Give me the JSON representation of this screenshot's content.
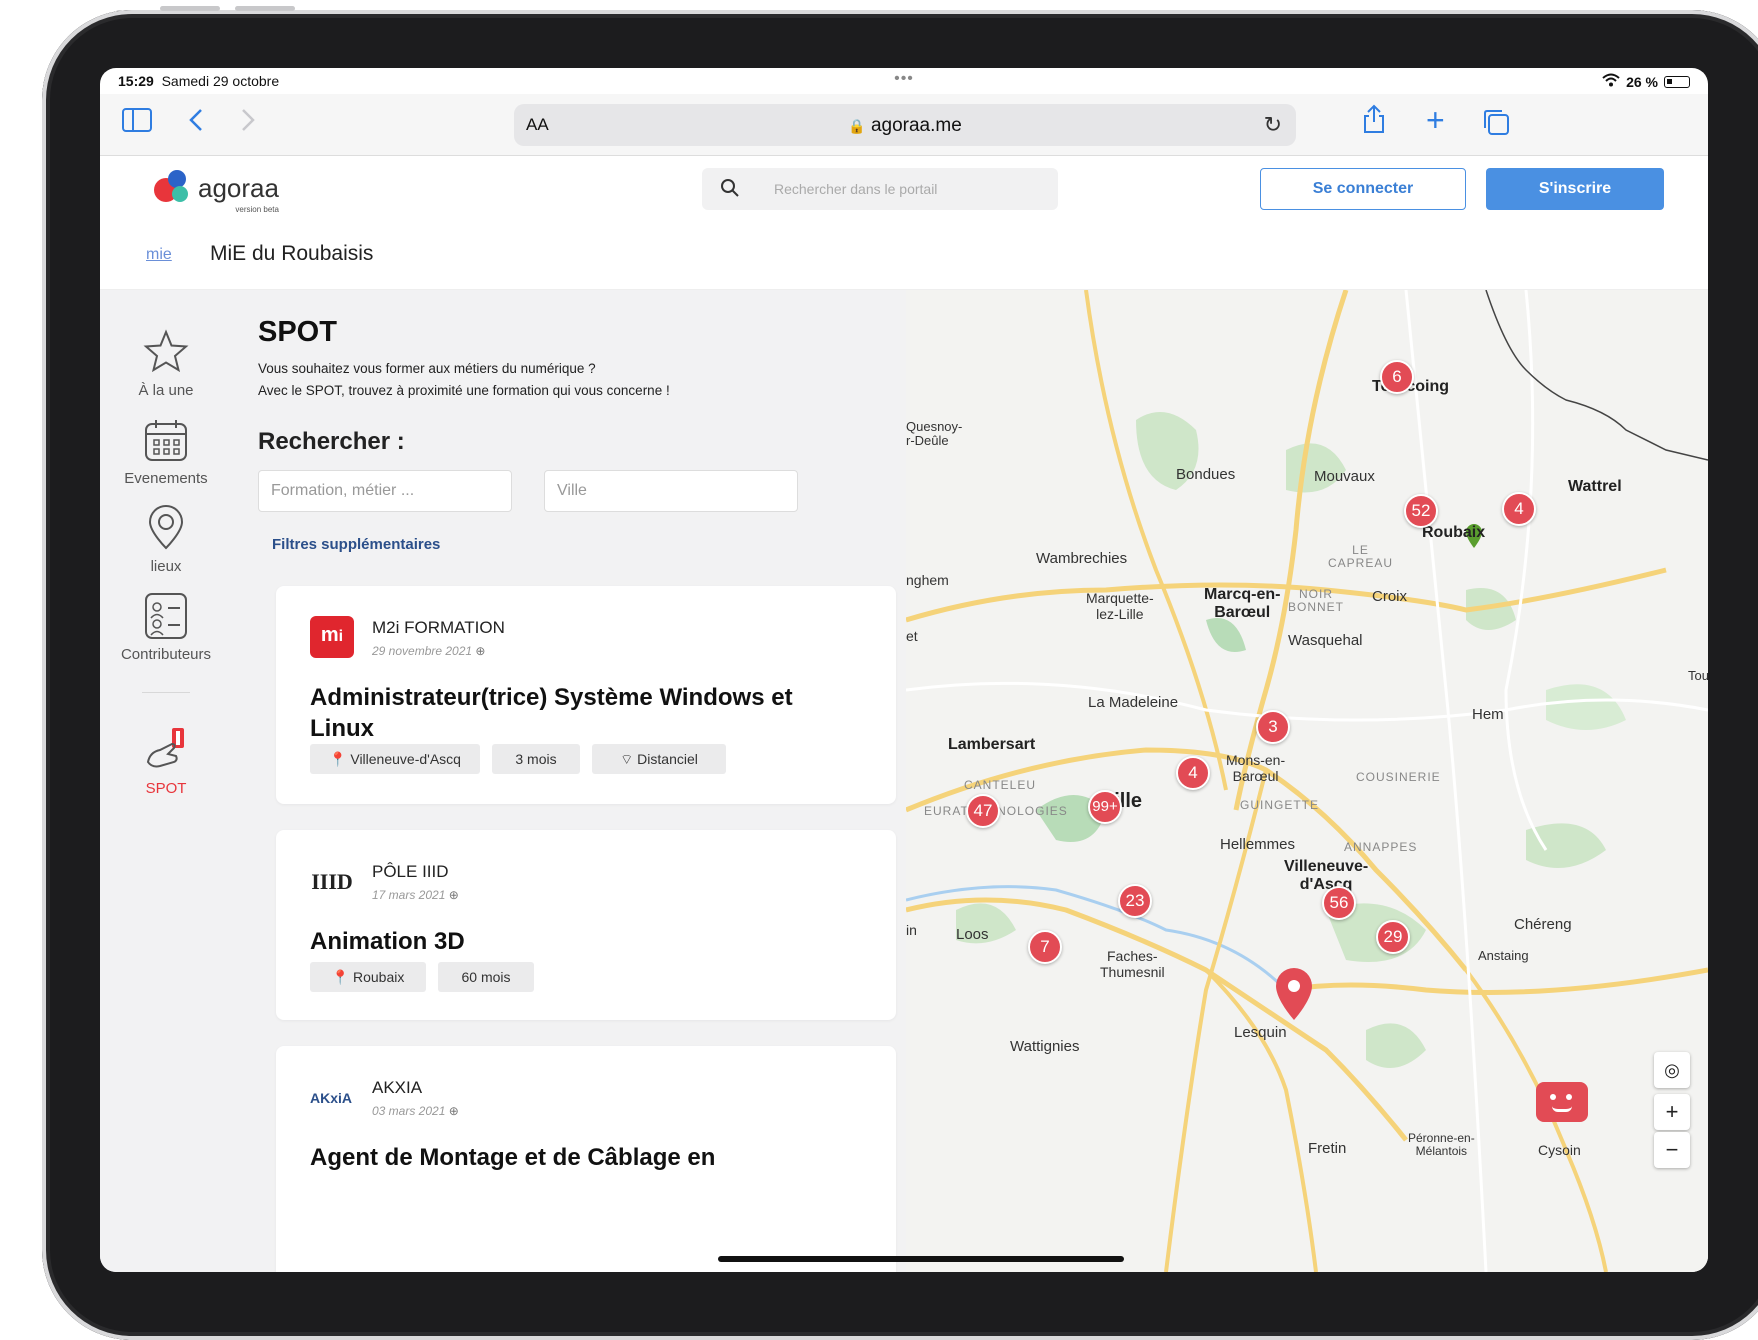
{
  "status_bar": {
    "time": "15:29",
    "date": "Samedi 29 octobre",
    "battery": "26 %"
  },
  "browser": {
    "text_size": "AA",
    "url": "agoraa.me"
  },
  "header": {
    "logo_text": "agoraa",
    "logo_sub": "version beta",
    "search_placeholder": "Rechercher dans le portail",
    "login_label": "Se connecter",
    "signup_label": "S'inscrire"
  },
  "org": {
    "short": "mie",
    "title": "MiE du Roubaisis"
  },
  "sidenav": {
    "items": [
      {
        "label": "À la une",
        "icon": "star-icon"
      },
      {
        "label": "Evenements",
        "icon": "calendar-icon"
      },
      {
        "label": "lieux",
        "icon": "location-pin-icon"
      },
      {
        "label": "Contributeurs",
        "icon": "contacts-icon"
      },
      {
        "label": "SPOT",
        "icon": "spot-hand-icon"
      }
    ]
  },
  "spot": {
    "title": "SPOT",
    "desc_line1": "Vous souhaitez vous former aux métiers du numérique ?",
    "desc_line2": "Avec le SPOT, trouvez à proximité une formation qui vous concerne !",
    "search_label": "Rechercher :",
    "formation_placeholder": "Formation, métier ...",
    "ville_placeholder": "Ville",
    "filters_label": "Filtres supplémentaires"
  },
  "cards": [
    {
      "org": "M2i FORMATION",
      "date": "29 novembre 2021",
      "title": "Administrateur(trice) Système Windows et Linux",
      "tags": [
        "Villeneuve-d'Ascq",
        "3 mois",
        "Distanciel"
      ]
    },
    {
      "org": "PÔLE IIID",
      "date": "17 mars 2021",
      "title": "Animation 3D",
      "tags": [
        "Roubaix",
        "60 mois"
      ]
    },
    {
      "org": "AKXIA",
      "date": "03 mars 2021",
      "title": "Agent de Montage et de Câblage en"
    }
  ],
  "map": {
    "labels": {
      "tourcoing": "Tourcoing",
      "roubaix": "Roubaix",
      "wattrelos": "Wattrel",
      "bondues": "Bondues",
      "mouvaux": "Mouvaux",
      "wambrechies": "Wambrechies",
      "marquette": "Marquette-\nlez-Lille",
      "marcq": "Marcq-en-\nBarœul",
      "croix": "Croix",
      "wasquehal": "Wasquehal",
      "madeleine": "La Madeleine",
      "lambersart": "Lambersart",
      "hem": "Hem",
      "mons": "Mons-en-\nBarœul",
      "lille": "Lille",
      "hellemmes": "Hellemmes",
      "villeneuve": "Villeneuve-\nd'Ascq",
      "loos": "Loos",
      "faches": "Faches-\nThumesnil",
      "chereng": "Chéreng",
      "anstaing": "Anstaing",
      "lesquin": "Lesquin",
      "wattignies": "Wattignies",
      "fretin": "Fretin",
      "peronne": "Péronne-en-\nMélantois",
      "cysoing": "Cysoin",
      "quesnoy": "Quesnoy-\nr-Deûle",
      "ghem": "nghem",
      "capreau": "LE\nCAPREAU",
      "noirbonnet": "NOIR\nBONNET",
      "canteleu": "CANTELEU",
      "euratechnologies": "EURATECHNOLOGIES",
      "cousinerie": "COUSINERIE",
      "guinguette": "GUINGETTE",
      "annappes": "ANNAPPES",
      "toufflers": "Tou",
      "et": "et",
      "in": "in"
    },
    "clusters": [
      "6",
      "52",
      "4",
      "3",
      "4",
      "47",
      "99+",
      "23",
      "7",
      "56",
      "29"
    ]
  }
}
